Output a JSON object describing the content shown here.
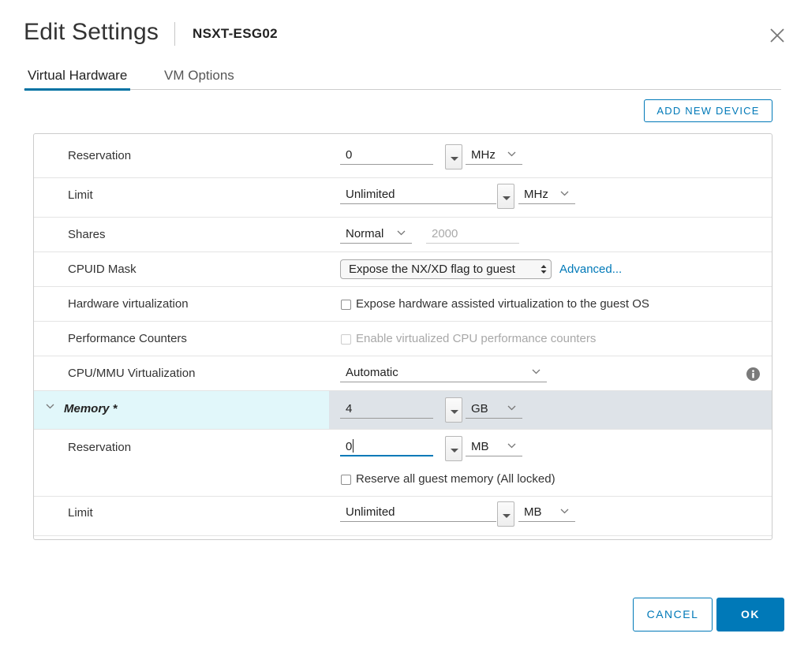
{
  "header": {
    "title": "Edit Settings",
    "vm_name": "NSXT-ESG02",
    "close_icon": "close-icon"
  },
  "tabs": [
    {
      "label": "Virtual Hardware",
      "active": true
    },
    {
      "label": "VM Options",
      "active": false
    }
  ],
  "toolbar": {
    "add_new_device_label": "ADD NEW DEVICE"
  },
  "cpu": {
    "reservation": {
      "label": "Reservation",
      "value": "0",
      "unit": "MHz"
    },
    "limit": {
      "label": "Limit",
      "value": "Unlimited",
      "unit": "MHz"
    },
    "shares": {
      "label": "Shares",
      "level": "Normal",
      "value": "2000"
    },
    "cpuid_mask": {
      "label": "CPUID Mask",
      "value": "Expose the NX/XD flag to guest",
      "advanced_link": "Advanced..."
    },
    "hardware_virtualization": {
      "label": "Hardware virtualization",
      "checkbox_label": "Expose hardware assisted virtualization to the guest OS",
      "checked": false
    },
    "performance_counters": {
      "label": "Performance Counters",
      "checkbox_label": "Enable virtualized CPU performance counters",
      "checked": false,
      "disabled": true
    },
    "cpu_mmu_virtualization": {
      "label": "CPU/MMU Virtualization",
      "value": "Automatic",
      "info_icon": "info-icon"
    }
  },
  "memory": {
    "label": "Memory *",
    "value": "4",
    "unit": "GB",
    "reservation": {
      "label": "Reservation",
      "value": "0",
      "unit": "MB",
      "reserve_all_label": "Reserve all guest memory (All locked)",
      "reserve_all_checked": false
    },
    "limit": {
      "label": "Limit",
      "value": "Unlimited",
      "unit": "MB"
    }
  },
  "footer": {
    "cancel_label": "CANCEL",
    "ok_label": "OK"
  },
  "colors": {
    "accent": "#0079b8",
    "memory_highlight": "#e1f7fa",
    "memory_row_bg": "#dee3e8"
  }
}
